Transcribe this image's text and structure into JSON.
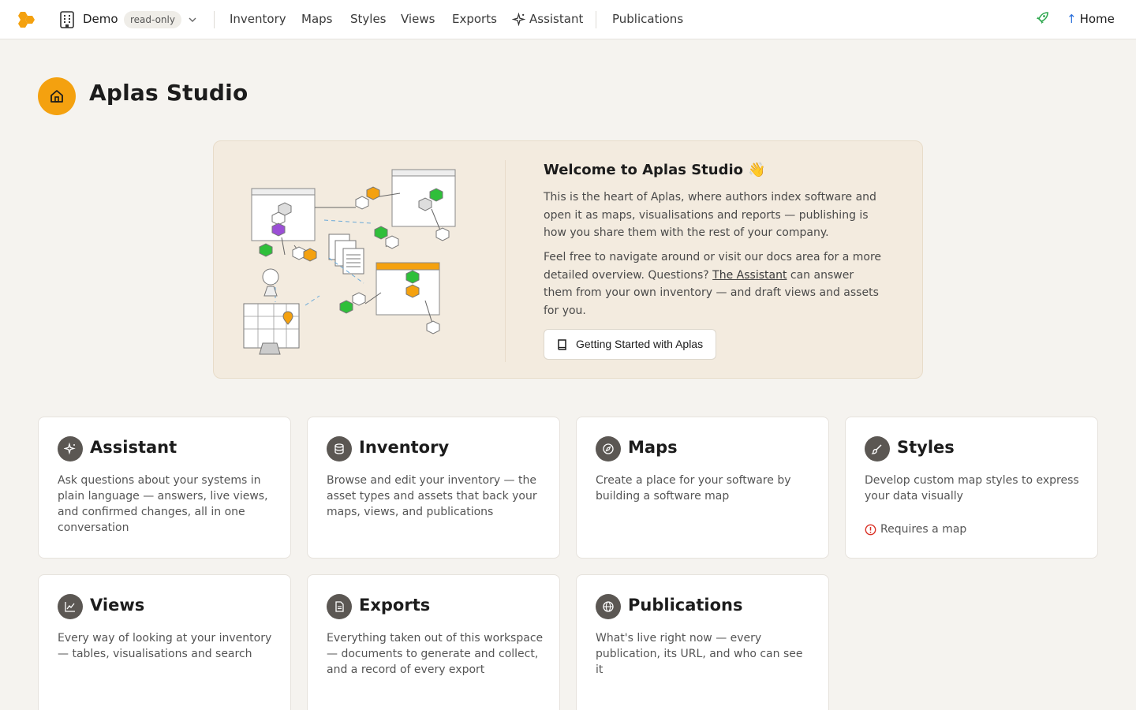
{
  "nav": {
    "workspace": "Demo",
    "badge": "read-only",
    "items": [
      "Inventory",
      "Maps",
      "Styles",
      "Views",
      "Exports",
      "Assistant",
      "Publications"
    ],
    "home": "Home"
  },
  "page": {
    "title": "Aplas Studio"
  },
  "welcome": {
    "title": "Welcome to Aplas Studio 👋",
    "p1": "This is the heart of Aplas, where authors index software and open it as maps, visualisations and reports — publishing is how you share them with the rest of your company.",
    "p2_before": "Feel free to navigate around or visit our docs area for a more detailed overview. Questions? ",
    "p2_link": "The Assistant",
    "p2_after": " can answer them from your own inventory — and draft views and assets for you.",
    "button": "Getting Started with Aplas"
  },
  "cards": [
    {
      "title": "Assistant",
      "icon": "sparkle-icon",
      "desc": "Ask questions about your systems in plain language — answers, live views, and confirmed changes, all in one conversation"
    },
    {
      "title": "Inventory",
      "icon": "database-icon",
      "desc": "Browse and edit your inventory — the asset types and assets that back your maps, views, and publications"
    },
    {
      "title": "Maps",
      "icon": "compass-icon",
      "desc": "Create a place for your software by building a software map"
    },
    {
      "title": "Styles",
      "icon": "brush-icon",
      "desc": "Develop custom map styles to express your data visually",
      "warning": "Requires a map"
    },
    {
      "title": "Views",
      "icon": "chart-icon",
      "desc": "Every way of looking at your inventory — tables, visualisations and search"
    },
    {
      "title": "Exports",
      "icon": "document-icon",
      "desc": "Everything taken out of this workspace — documents to generate and collect, and a record of every export"
    },
    {
      "title": "Publications",
      "icon": "globe-icon",
      "desc": "What's live right now — every publication, its URL, and who can see it"
    }
  ],
  "colors": {
    "accent": "#f4a10f",
    "background": "#f5f3ef",
    "panel": "#f3ebdf",
    "warning": "#d93025",
    "link_arrow": "#2a6fdb",
    "rocket": "#2fa84f"
  }
}
